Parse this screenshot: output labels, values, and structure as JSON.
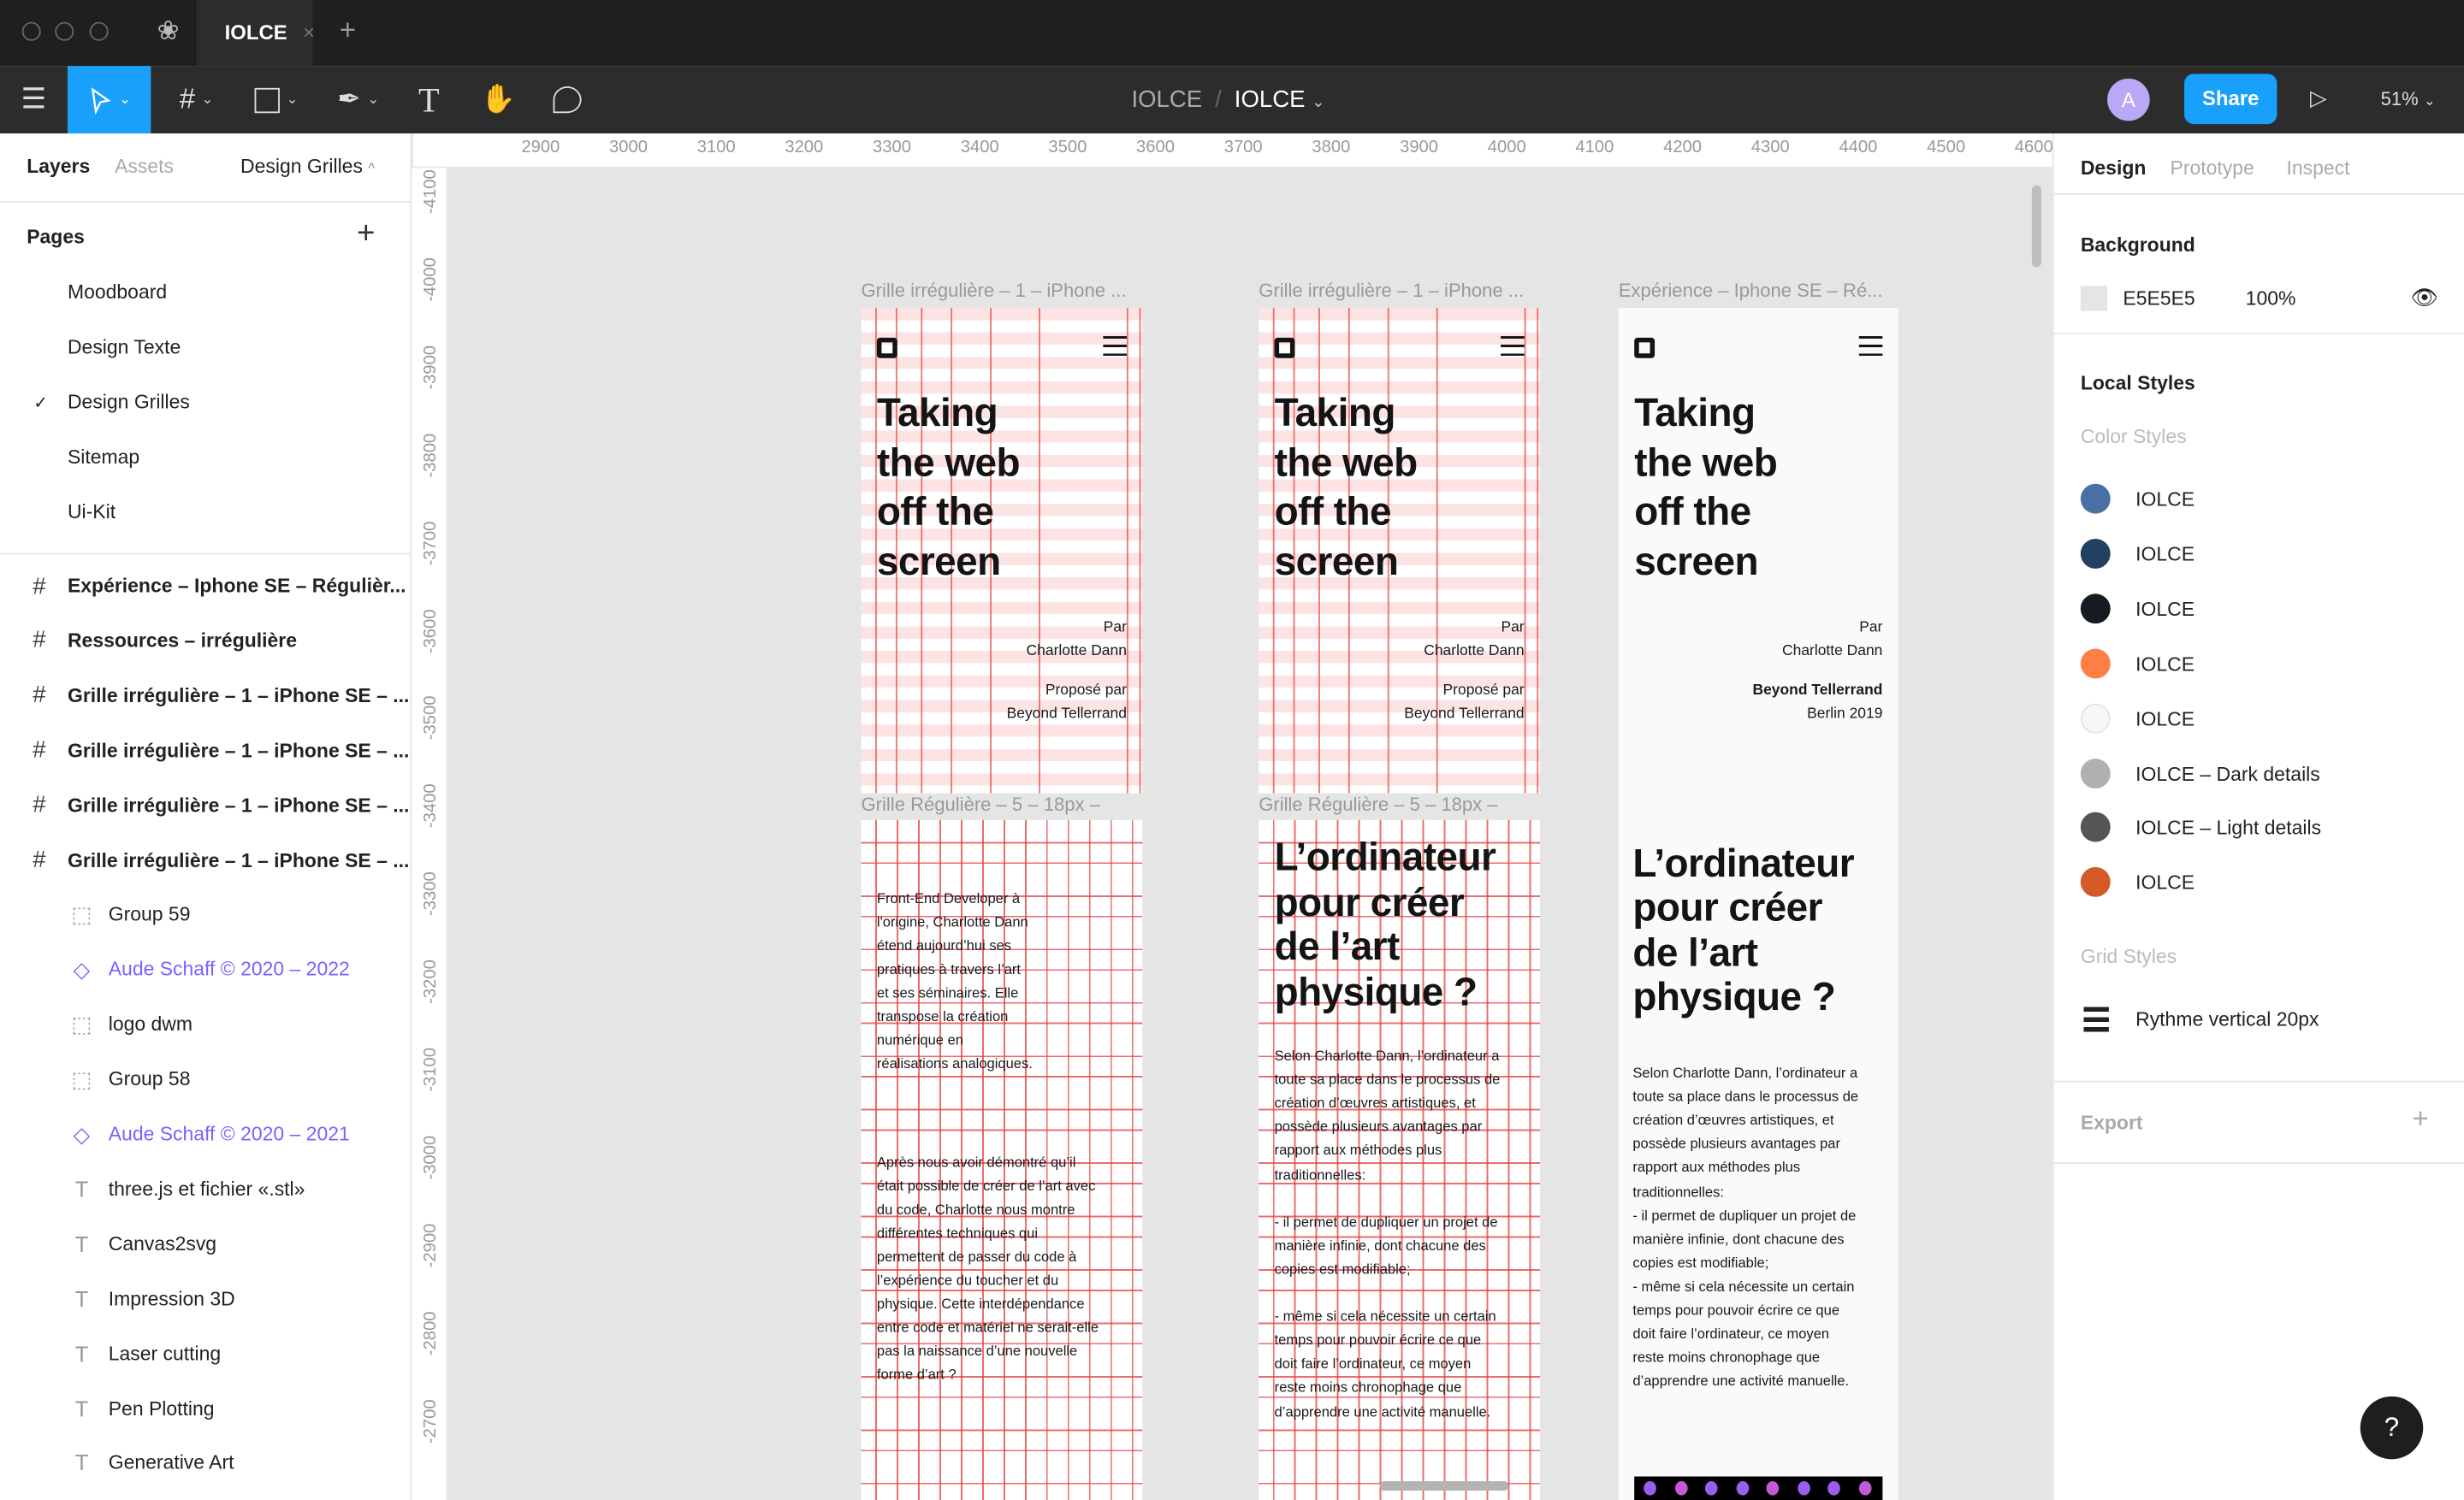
{
  "titlebar": {
    "tab_title": "IOLCE",
    "tab_close": "×",
    "new_tab": "+"
  },
  "toolbar": {
    "breadcrumb_team": "IOLCE",
    "breadcrumb_sep": "/",
    "breadcrumb_file": "IOLCE",
    "avatar_initial": "A",
    "avatar_color": "#b9a8f5",
    "share_label": "Share",
    "zoom": "51%",
    "accent": "#18a0fb",
    "tools": [
      "menu-icon",
      "move-tool-icon",
      "frame-tool-icon",
      "rectangle-tool-icon",
      "pen-tool-icon",
      "text-tool-icon",
      "hand-tool-icon",
      "comment-tool-icon"
    ]
  },
  "left_panel": {
    "tabs": [
      "Layers",
      "Assets"
    ],
    "current_page": "Design Grilles",
    "pages_title": "Pages",
    "pages": [
      {
        "label": "Moodboard",
        "selected": false
      },
      {
        "label": "Design Texte",
        "selected": false
      },
      {
        "label": "Design Grilles",
        "selected": true
      },
      {
        "label": "Sitemap",
        "selected": false
      },
      {
        "label": "Ui-Kit",
        "selected": false
      }
    ],
    "layers": [
      {
        "label": "Expérience – Iphone SE – Régulièr...",
        "icon": "frame-icon",
        "bold": true
      },
      {
        "label": "Ressources – irrégulière",
        "icon": "frame-icon",
        "bold": true
      },
      {
        "label": "Grille irrégulière – 1 – iPhone SE – ...",
        "icon": "frame-icon",
        "bold": true
      },
      {
        "label": "Grille irrégulière – 1 – iPhone SE – ...",
        "icon": "frame-icon",
        "bold": true
      },
      {
        "label": "Grille irrégulière – 1 – iPhone SE – ...",
        "icon": "frame-icon",
        "bold": true
      },
      {
        "label": "Grille irrégulière – 1 – iPhone SE – ...",
        "icon": "frame-icon",
        "bold": true
      },
      {
        "label": "Group 59",
        "icon": "group-icon"
      },
      {
        "label": "Aude Schaff © 2020 – 2022",
        "icon": "component-icon"
      },
      {
        "label": "logo dwm",
        "icon": "group-icon"
      },
      {
        "label": "Group 58",
        "icon": "group-icon"
      },
      {
        "label": "Aude Schaff © 2020 – 2021",
        "icon": "component-icon"
      },
      {
        "label": "three.js et fichier «.stl»",
        "icon": "text-icon"
      },
      {
        "label": "Canvas2svg",
        "icon": "text-icon"
      },
      {
        "label": "Impression 3D",
        "icon": "text-icon"
      },
      {
        "label": "Laser cutting",
        "icon": "text-icon"
      },
      {
        "label": "Pen Plotting",
        "icon": "text-icon"
      },
      {
        "label": "Generative Art",
        "icon": "text-icon"
      }
    ],
    "component_color": "#7b61ff"
  },
  "rulers": {
    "x_ticks": [
      "2900",
      "3000",
      "3100",
      "3200",
      "3300",
      "3400",
      "3500",
      "3600",
      "3700",
      "3800",
      "3900",
      "4000",
      "4100",
      "4200",
      "4300",
      "4400",
      "4500",
      "4600"
    ],
    "y_ticks": [
      "-4100",
      "-4000",
      "-3900",
      "-3800",
      "-3700",
      "-3600",
      "-3500",
      "-3400",
      "-3300",
      "-3200",
      "-3100",
      "-3000",
      "-2900",
      "-2800",
      "-2700"
    ]
  },
  "canvas": {
    "frame_labels_top": [
      "Grille irrégulière – 1 – iPhone ...",
      "Grille irrégulière – 1 – iPhone ...",
      "Expérience – Iphone SE – Ré..."
    ],
    "frame_labels_bottom": [
      "Grille Régulière – 5 – 18px –",
      "Grille Régulière – 5 – 18px –"
    ],
    "hero_title": [
      "Taking",
      "the web",
      "off the",
      "screen"
    ],
    "credits_grid": [
      "Par",
      "Charlotte Dann",
      "Proposé par",
      "Beyond Tellerrand"
    ],
    "credits_final": [
      "Par",
      "Charlotte Dann",
      "Beyond Tellerrand",
      "Berlin 2019"
    ],
    "intro": [
      "Front-End Developer à",
      "l'origine, Charlotte Dann",
      "étend aujourd’hui ses",
      "pratiques à travers l’art",
      "et ses séminaires. Elle",
      "transpose la création",
      "numérique en",
      "réalisations analogiques."
    ],
    "intro_2": [
      "Après nous avoir démontré qu’il",
      "était possible de créer de l’art avec",
      "du code, Charlotte nous montre",
      "différentes techniques qui",
      "permettent de passer du code à",
      "l’expérience du toucher et du",
      "physique. Cette interdépendance",
      "entre code et matériel ne serait-elle",
      "pas la naissance d’une nouvelle",
      "forme d’art ?"
    ],
    "section_title": [
      "L’ordinateur",
      "pour créer",
      "de l’art",
      "physique ?"
    ],
    "section_body_grid": [
      "Selon Charlotte Dann, l’ordinateur a",
      "toute sa place dans le processus de",
      "création d’œuvres artistiques, et",
      "possède plusieurs avantages par",
      "rapport aux méthodes plus",
      "traditionnelles:",
      "",
      "- il permet de dupliquer un projet de",
      "manière infinie, dont chacune des",
      "copies est modifiable;",
      "",
      "- même si cela nécessite un certain",
      "temps pour pouvoir écrire ce que",
      "doit faire l’ordinateur, ce moyen",
      "reste moins chronophage que",
      "d’apprendre une activité manuelle."
    ],
    "section_body_final": [
      "Selon Charlotte Dann, l’ordinateur a",
      "toute sa place dans le processus de",
      "création d’œuvres artistiques, et",
      "possède plusieurs avantages par",
      "rapport aux méthodes plus",
      "traditionnelles:",
      "- il permet de dupliquer un projet de",
      "manière infinie, dont chacune des",
      "copies est modifiable;",
      "- même si cela nécessite un certain",
      "temps pour pouvoir écrire ce que",
      "doit faire l’ordinateur, ce moyen",
      "reste moins chronophage que",
      "d’apprendre une activité manuelle."
    ]
  },
  "right_panel": {
    "tabs": [
      "Design",
      "Prototype",
      "Inspect"
    ],
    "background_title": "Background",
    "background_hex": "E5E5E5",
    "background_opacity": "100%",
    "local_styles_title": "Local Styles",
    "color_styles_title": "Color Styles",
    "color_styles": [
      {
        "name": "IOLCE",
        "color": "#4a6fa5"
      },
      {
        "name": "IOLCE",
        "color": "#22405f"
      },
      {
        "name": "IOLCE",
        "color": "#161c24"
      },
      {
        "name": "IOLCE",
        "color": "#fd7f45"
      },
      {
        "name": "IOLCE",
        "color": "#f7f7f7"
      },
      {
        "name": "IOLCE – Dark details",
        "color": "#b0b0b0"
      },
      {
        "name": "IOLCE – Light details",
        "color": "#555555"
      },
      {
        "name": "IOLCE",
        "color": "#d45a2a"
      }
    ],
    "grid_styles_title": "Grid Styles",
    "grid_styles": [
      "Rythme vertical 20px"
    ],
    "export_title": "Export",
    "export_add": "+"
  },
  "help": {
    "label": "?"
  }
}
